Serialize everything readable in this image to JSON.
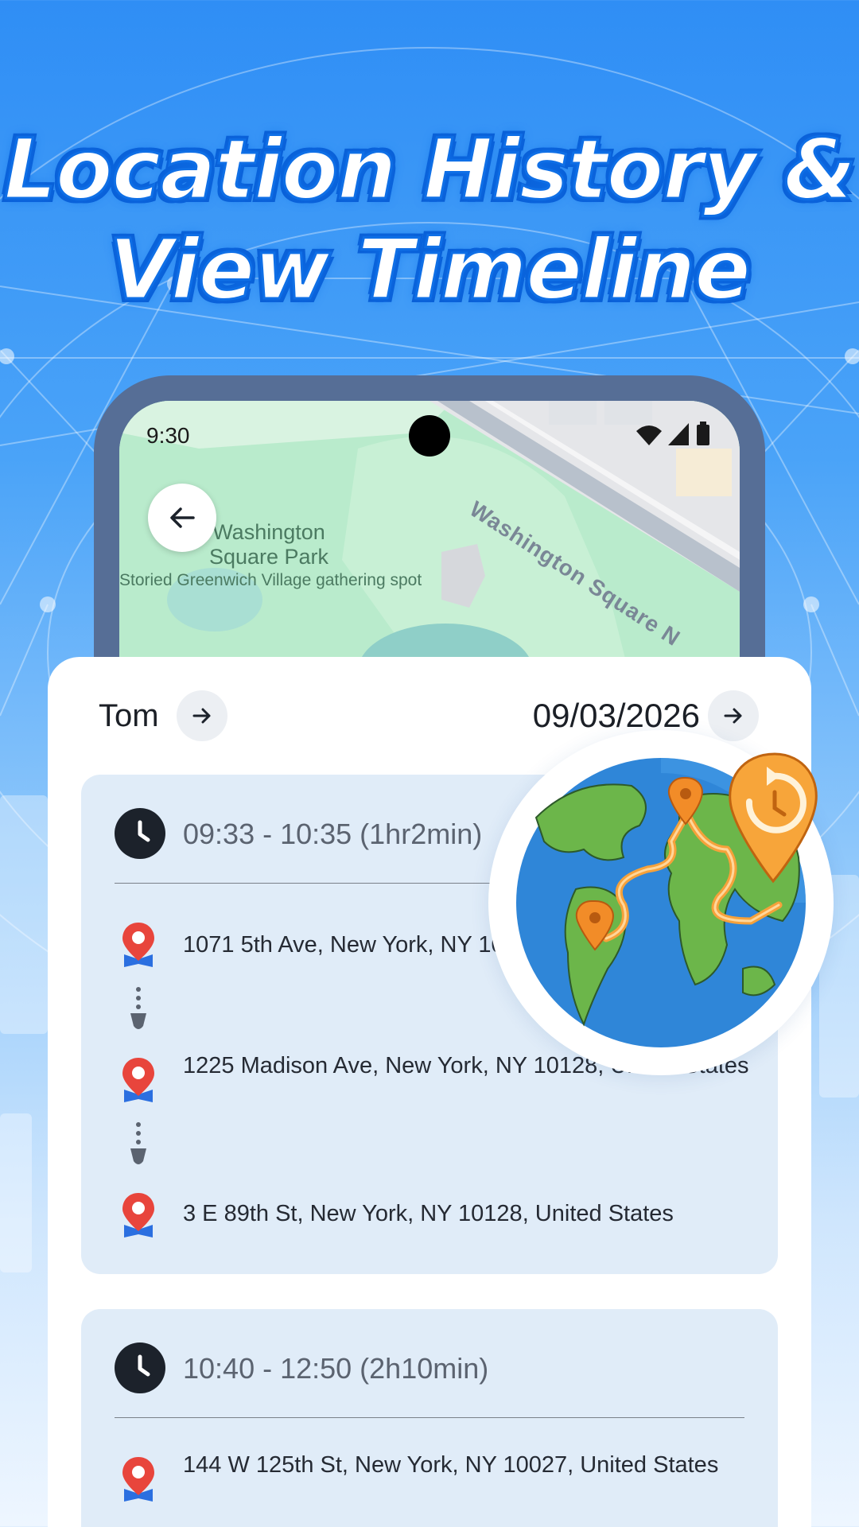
{
  "headline": {
    "line1": "Location History &",
    "line2": "View Timeline"
  },
  "status_bar": {
    "time": "9:30"
  },
  "map": {
    "park_name_1": "Washington",
    "park_name_2": "Square Park",
    "park_description": "Storied Greenwich Village gathering spot",
    "street_name": "Washington Square N"
  },
  "timeline": {
    "person": "Tom",
    "date": "09/03/2026",
    "entries": [
      {
        "time_range": "09:33 - 10:35 (1hr2min)",
        "stops": [
          "1071 5th Ave, New York, NY 10128, United States",
          "1225 Madison Ave, New York, NY 10128, United States",
          "3 E 89th St, New York, NY 10128, United States"
        ]
      },
      {
        "time_range": "10:40 - 12:50 (2h10min)",
        "stops": [
          "144 W 125th St, New York, NY 10027, United States"
        ]
      }
    ]
  },
  "icons": {
    "back": "arrow-left-icon",
    "next": "arrow-right-icon",
    "clock": "clock-icon",
    "pin": "location-pin-icon",
    "globe": "globe-route-icon"
  },
  "colors": {
    "accent": "#1476f0",
    "pin_red": "#e8453c",
    "pin_blue": "#2b6fe0",
    "card_block": "#e0ecf8"
  }
}
